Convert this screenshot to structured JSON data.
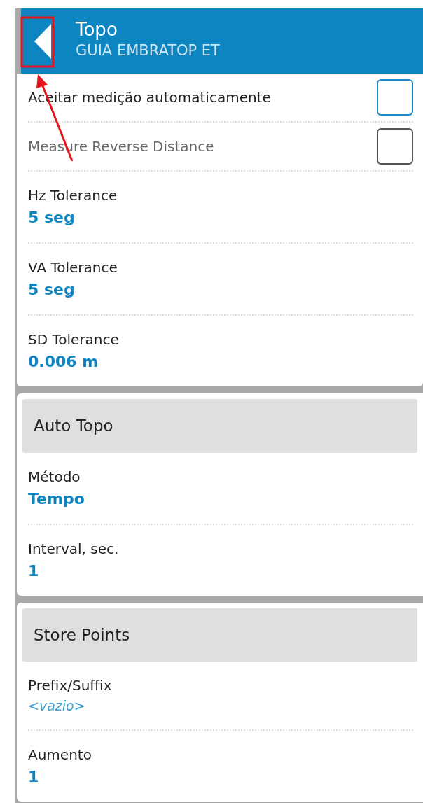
{
  "header": {
    "title": "Topo",
    "subtitle": "GUIA EMBRATOP ET"
  },
  "annotation": {
    "highlight_box": true,
    "arrow": true
  },
  "sections": [
    {
      "items": [
        {
          "kind": "checkbox",
          "label": "Aceitar medição automaticamente",
          "checked": false,
          "disabled": false
        },
        {
          "kind": "checkbox",
          "label": "Measure Reverse Distance",
          "checked": false,
          "disabled": true
        },
        {
          "kind": "value",
          "label": "Hz Tolerance",
          "value": "5 seg",
          "empty": false
        },
        {
          "kind": "value",
          "label": "VA Tolerance",
          "value": "5 seg",
          "empty": false
        },
        {
          "kind": "value",
          "label": "SD Tolerance",
          "value": "0.006 m",
          "empty": false
        }
      ]
    },
    {
      "title": "Auto Topo",
      "items": [
        {
          "kind": "value",
          "label": "Método",
          "value": "Tempo",
          "empty": false
        },
        {
          "kind": "value",
          "label": "Interval, sec.",
          "value": "1",
          "empty": false
        }
      ]
    },
    {
      "title": "Store Points",
      "items": [
        {
          "kind": "value",
          "label": "Prefix/Suffix",
          "value": "<vazio>",
          "empty": true
        },
        {
          "kind": "value",
          "label": "Aumento",
          "value": "1",
          "empty": false
        }
      ]
    }
  ]
}
